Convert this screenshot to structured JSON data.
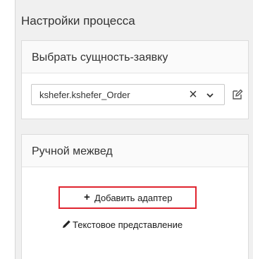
{
  "process_settings": {
    "title": "Настройки процесса",
    "entity_card": {
      "header": "Выбрать сущность-заявку",
      "selected_value": "kshefer.kshefer_Order",
      "clear_icon": "close-icon",
      "dropdown_icon": "chevron-down-icon",
      "edit_icon": "edit-icon"
    },
    "manual_input_card": {
      "header": "Ручной межвед",
      "add_adapter_label": "Добавить адаптер",
      "add_adapter_icon": "plus-icon",
      "text_view_label": "Текстовое представление",
      "text_view_icon": "pencil-icon",
      "highlight_color": "#e0242f"
    }
  }
}
